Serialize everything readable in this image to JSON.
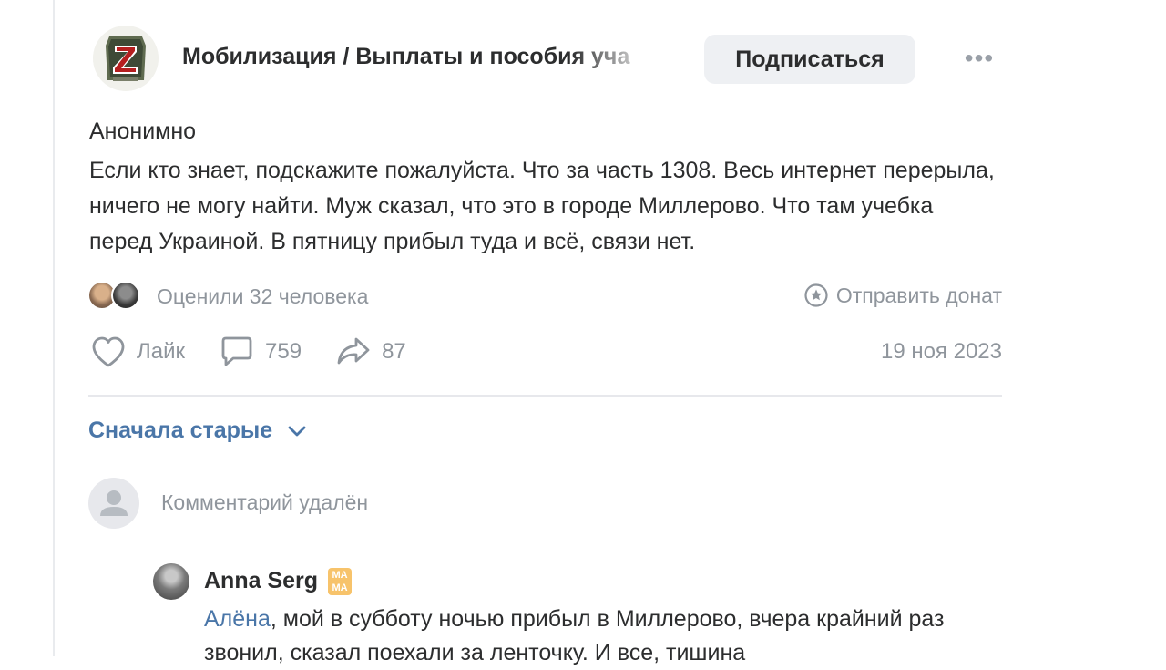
{
  "post": {
    "group_name": "Мобилизация / Выплаты и пособия уча",
    "group_avatar_icon": "z-emblem-icon",
    "subscribe_label": "Подписаться",
    "more_icon": "more-horizontal-icon",
    "author": "Анонимно",
    "text": "Если кто знает, подскажите пожалуйста. Что за часть 1308. Весь интернет перерыла, ничего не могу найти. Муж сказал, что это в городе Миллерово. Что там учебка перед Украиной. В пятницу прибыл туда и всё, связи нет.",
    "likes_summary": "Оценили 32 человека",
    "donate_label": "Отправить донат",
    "like_label": "Лайк",
    "comments_count": "759",
    "shares_count": "87",
    "date": "19 ноя 2023",
    "accent_color": "#4a76a8"
  },
  "comments": {
    "sort_label": "Сначала старые",
    "deleted_text": "Комментарий удалён",
    "reply": {
      "author": "Anna Serg",
      "badge": "MA MA",
      "mention": "Алёна",
      "text": ", мой в субботу ночью прибыл в Миллерово, вчера крайний раз звонил, сказал поехали за ленточку. И все, тишина"
    }
  }
}
